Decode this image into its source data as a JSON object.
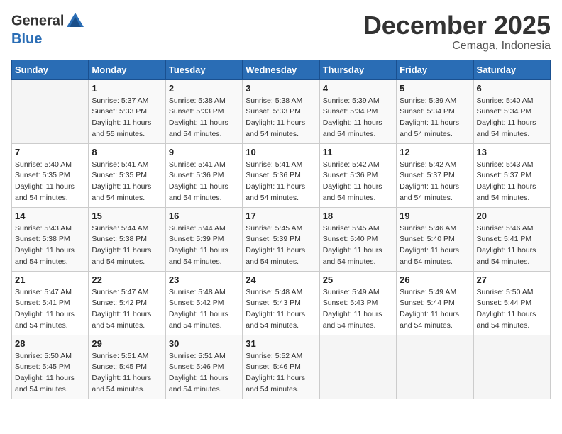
{
  "header": {
    "logo_line1": "General",
    "logo_line2": "Blue",
    "month": "December 2025",
    "location": "Cemaga, Indonesia"
  },
  "columns": [
    "Sunday",
    "Monday",
    "Tuesday",
    "Wednesday",
    "Thursday",
    "Friday",
    "Saturday"
  ],
  "weeks": [
    [
      {
        "day": "",
        "info": ""
      },
      {
        "day": "1",
        "info": "Sunrise: 5:37 AM\nSunset: 5:33 PM\nDaylight: 11 hours\nand 55 minutes."
      },
      {
        "day": "2",
        "info": "Sunrise: 5:38 AM\nSunset: 5:33 PM\nDaylight: 11 hours\nand 54 minutes."
      },
      {
        "day": "3",
        "info": "Sunrise: 5:38 AM\nSunset: 5:33 PM\nDaylight: 11 hours\nand 54 minutes."
      },
      {
        "day": "4",
        "info": "Sunrise: 5:39 AM\nSunset: 5:34 PM\nDaylight: 11 hours\nand 54 minutes."
      },
      {
        "day": "5",
        "info": "Sunrise: 5:39 AM\nSunset: 5:34 PM\nDaylight: 11 hours\nand 54 minutes."
      },
      {
        "day": "6",
        "info": "Sunrise: 5:40 AM\nSunset: 5:34 PM\nDaylight: 11 hours\nand 54 minutes."
      }
    ],
    [
      {
        "day": "7",
        "info": "Sunrise: 5:40 AM\nSunset: 5:35 PM\nDaylight: 11 hours\nand 54 minutes."
      },
      {
        "day": "8",
        "info": "Sunrise: 5:41 AM\nSunset: 5:35 PM\nDaylight: 11 hours\nand 54 minutes."
      },
      {
        "day": "9",
        "info": "Sunrise: 5:41 AM\nSunset: 5:36 PM\nDaylight: 11 hours\nand 54 minutes."
      },
      {
        "day": "10",
        "info": "Sunrise: 5:41 AM\nSunset: 5:36 PM\nDaylight: 11 hours\nand 54 minutes."
      },
      {
        "day": "11",
        "info": "Sunrise: 5:42 AM\nSunset: 5:36 PM\nDaylight: 11 hours\nand 54 minutes."
      },
      {
        "day": "12",
        "info": "Sunrise: 5:42 AM\nSunset: 5:37 PM\nDaylight: 11 hours\nand 54 minutes."
      },
      {
        "day": "13",
        "info": "Sunrise: 5:43 AM\nSunset: 5:37 PM\nDaylight: 11 hours\nand 54 minutes."
      }
    ],
    [
      {
        "day": "14",
        "info": "Sunrise: 5:43 AM\nSunset: 5:38 PM\nDaylight: 11 hours\nand 54 minutes."
      },
      {
        "day": "15",
        "info": "Sunrise: 5:44 AM\nSunset: 5:38 PM\nDaylight: 11 hours\nand 54 minutes."
      },
      {
        "day": "16",
        "info": "Sunrise: 5:44 AM\nSunset: 5:39 PM\nDaylight: 11 hours\nand 54 minutes."
      },
      {
        "day": "17",
        "info": "Sunrise: 5:45 AM\nSunset: 5:39 PM\nDaylight: 11 hours\nand 54 minutes."
      },
      {
        "day": "18",
        "info": "Sunrise: 5:45 AM\nSunset: 5:40 PM\nDaylight: 11 hours\nand 54 minutes."
      },
      {
        "day": "19",
        "info": "Sunrise: 5:46 AM\nSunset: 5:40 PM\nDaylight: 11 hours\nand 54 minutes."
      },
      {
        "day": "20",
        "info": "Sunrise: 5:46 AM\nSunset: 5:41 PM\nDaylight: 11 hours\nand 54 minutes."
      }
    ],
    [
      {
        "day": "21",
        "info": "Sunrise: 5:47 AM\nSunset: 5:41 PM\nDaylight: 11 hours\nand 54 minutes."
      },
      {
        "day": "22",
        "info": "Sunrise: 5:47 AM\nSunset: 5:42 PM\nDaylight: 11 hours\nand 54 minutes."
      },
      {
        "day": "23",
        "info": "Sunrise: 5:48 AM\nSunset: 5:42 PM\nDaylight: 11 hours\nand 54 minutes."
      },
      {
        "day": "24",
        "info": "Sunrise: 5:48 AM\nSunset: 5:43 PM\nDaylight: 11 hours\nand 54 minutes."
      },
      {
        "day": "25",
        "info": "Sunrise: 5:49 AM\nSunset: 5:43 PM\nDaylight: 11 hours\nand 54 minutes."
      },
      {
        "day": "26",
        "info": "Sunrise: 5:49 AM\nSunset: 5:44 PM\nDaylight: 11 hours\nand 54 minutes."
      },
      {
        "day": "27",
        "info": "Sunrise: 5:50 AM\nSunset: 5:44 PM\nDaylight: 11 hours\nand 54 minutes."
      }
    ],
    [
      {
        "day": "28",
        "info": "Sunrise: 5:50 AM\nSunset: 5:45 PM\nDaylight: 11 hours\nand 54 minutes."
      },
      {
        "day": "29",
        "info": "Sunrise: 5:51 AM\nSunset: 5:45 PM\nDaylight: 11 hours\nand 54 minutes."
      },
      {
        "day": "30",
        "info": "Sunrise: 5:51 AM\nSunset: 5:46 PM\nDaylight: 11 hours\nand 54 minutes."
      },
      {
        "day": "31",
        "info": "Sunrise: 5:52 AM\nSunset: 5:46 PM\nDaylight: 11 hours\nand 54 minutes."
      },
      {
        "day": "",
        "info": ""
      },
      {
        "day": "",
        "info": ""
      },
      {
        "day": "",
        "info": ""
      }
    ]
  ]
}
